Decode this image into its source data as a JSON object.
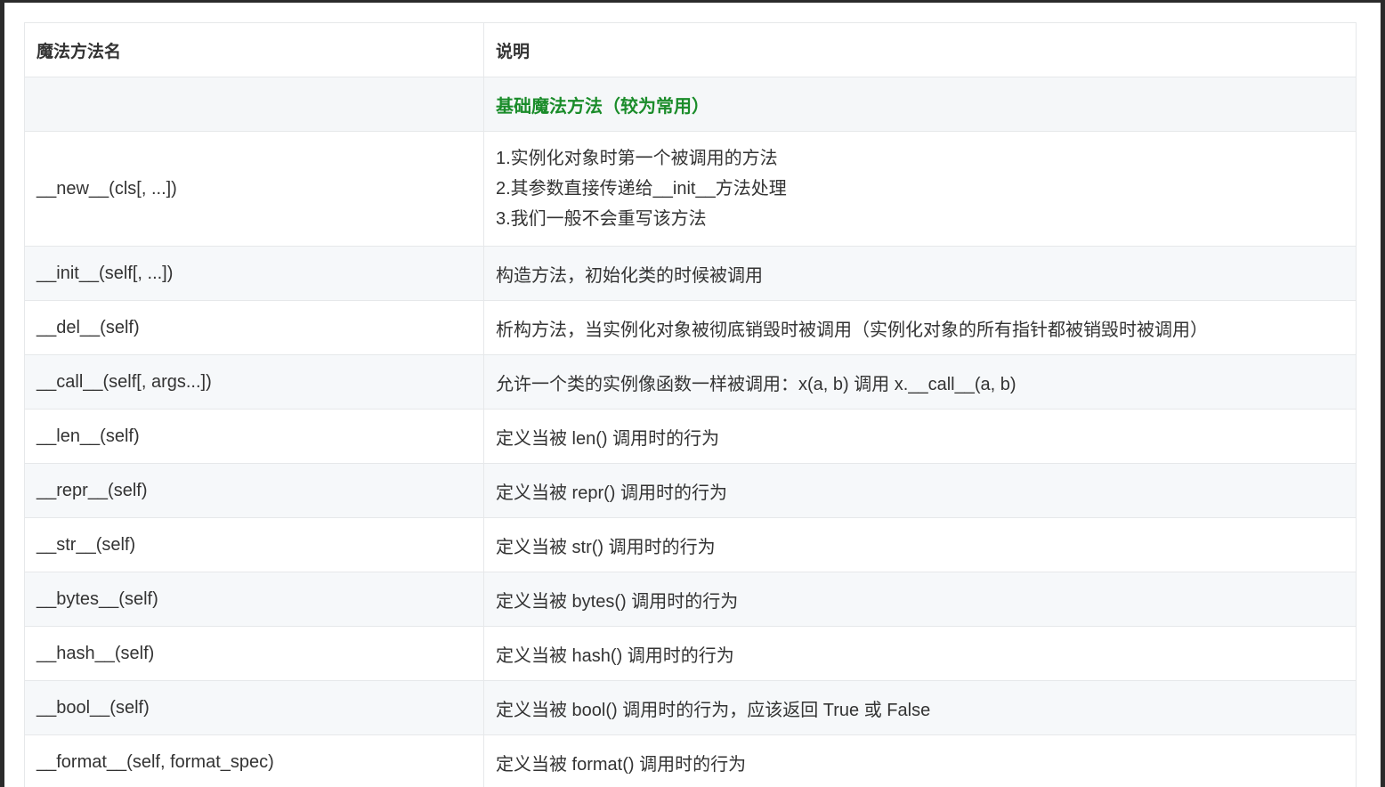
{
  "table": {
    "headers": {
      "name": "魔法方法名",
      "desc": "说明"
    },
    "group_title": "基础魔法方法（较为常用）",
    "rows": [
      {
        "name": "__new__(cls[, ...])",
        "desc_lines": [
          "1.实例化对象时第一个被调用的方法",
          "2.其参数直接传递给__init__方法处理",
          "3.我们一般不会重写该方法"
        ]
      },
      {
        "name": "__init__(self[, ...])",
        "desc": "构造方法，初始化类的时候被调用"
      },
      {
        "name": "__del__(self)",
        "desc": "析构方法，当实例化对象被彻底销毁时被调用（实例化对象的所有指针都被销毁时被调用）"
      },
      {
        "name": "__call__(self[, args...])",
        "desc": "允许一个类的实例像函数一样被调用：x(a, b) 调用 x.__call__(a, b)"
      },
      {
        "name": "__len__(self)",
        "desc": "定义当被 len() 调用时的行为"
      },
      {
        "name": "__repr__(self)",
        "desc": "定义当被 repr() 调用时的行为"
      },
      {
        "name": "__str__(self)",
        "desc": "定义当被 str() 调用时的行为"
      },
      {
        "name": "__bytes__(self)",
        "desc": "定义当被 bytes() 调用时的行为"
      },
      {
        "name": "__hash__(self)",
        "desc": "定义当被 hash() 调用时的行为"
      },
      {
        "name": "__bool__(self)",
        "desc": "定义当被 bool() 调用时的行为，应该返回 True 或 False"
      },
      {
        "name": "__format__(self, format_spec)",
        "desc": "定义当被 format() 调用时的行为"
      }
    ]
  },
  "colors": {
    "group_title": "#1a8c2a",
    "text": "#333333",
    "border": "#e6e8ea",
    "alt_row": "#f6f8fa"
  }
}
